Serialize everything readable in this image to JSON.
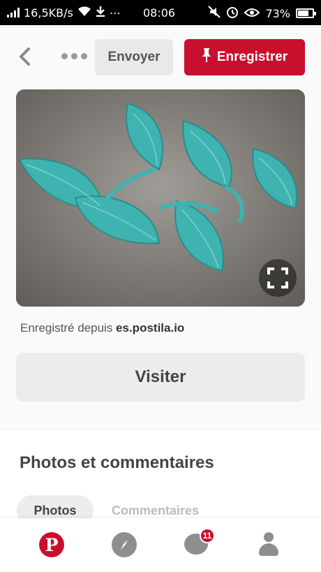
{
  "status_bar": {
    "speed": "16,5KB/s",
    "time": "08:06",
    "battery": "73%",
    "battery_level": 0.73
  },
  "toolbar": {
    "send_label": "Envoyer",
    "save_label": "Enregistrer"
  },
  "pin": {
    "saved_from_prefix": "Enregistré depuis",
    "saved_from_domain": "es.postila.io",
    "visit_label": "Visiter"
  },
  "section": {
    "title": "Photos et commentaires",
    "tabs": [
      "Photos",
      "Commentaires"
    ]
  },
  "bottom_nav": {
    "home_glyph": "P",
    "notification_count": "11"
  },
  "colors": {
    "brand_red": "#c8102e",
    "crochet_teal": "#3fb3b0"
  }
}
